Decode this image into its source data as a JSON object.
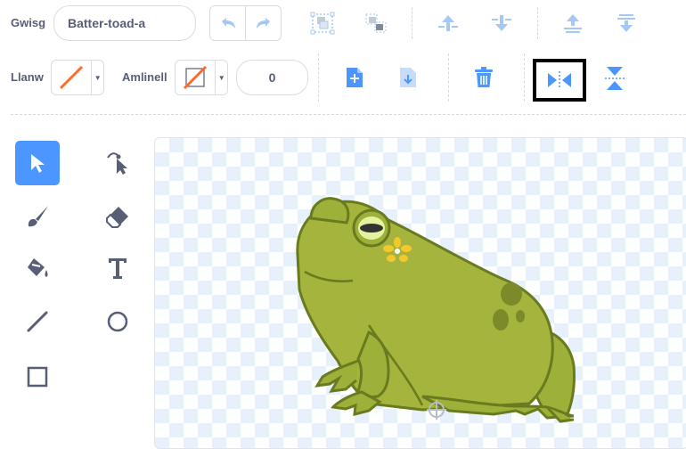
{
  "toolbar": {
    "costume_label": "Gwisg",
    "costume_name": "Batter-toad-a",
    "fill_label": "Llanw",
    "outline_label": "Amlinell",
    "outline_width": "0",
    "fill_color": "#ff6a2a",
    "outline_color": "#ff6a2a",
    "highlighted_tool": "flip-horizontal"
  },
  "tools": [
    {
      "name": "select",
      "active": true
    },
    {
      "name": "reshape"
    },
    {
      "name": "brush"
    },
    {
      "name": "eraser"
    },
    {
      "name": "fill"
    },
    {
      "name": "text"
    },
    {
      "name": "line"
    },
    {
      "name": "circle"
    },
    {
      "name": "rectangle"
    }
  ],
  "colors": {
    "accent": "#4c97ff",
    "text": "#575e75",
    "frog_body": "#9cb03a",
    "frog_outline": "#6a7a1e"
  }
}
